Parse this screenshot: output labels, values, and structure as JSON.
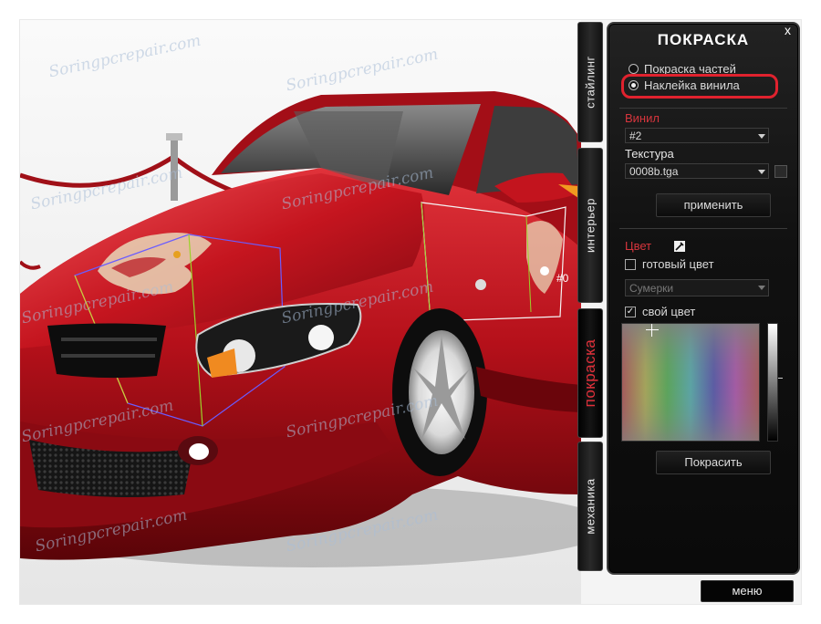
{
  "watermark_text": "Soringpcrepair.com",
  "scene": {
    "gizmo_label": "#0"
  },
  "tabs": [
    {
      "label": "стайлинг"
    },
    {
      "label": "интерьер"
    },
    {
      "label": "покраска",
      "active": true
    },
    {
      "label": "механика"
    }
  ],
  "panel": {
    "title": "ПОКРАСКА",
    "close_label": "x",
    "radio_options": [
      {
        "label": "Покраска частей",
        "selected": false
      },
      {
        "label": "Наклейка винила",
        "selected": true
      }
    ],
    "vinyl_label": "Винил",
    "vinyl_value": "#2",
    "texture_label": "Текстура",
    "texture_value": "0008b.tga",
    "apply_button": "применить",
    "color_label": "Цвет",
    "ready_color_label": "готовый цвет",
    "ready_color_checked": false,
    "preset_value": "Сумерки",
    "own_color_label": "свой цвет",
    "own_color_checked": true,
    "paint_button": "Покрасить"
  },
  "menu_button": "меню",
  "colors": {
    "accent_red": "#e0222e",
    "car_red": "#b8121c",
    "panel_bg": "#111111"
  },
  "icons": [
    "close-icon",
    "eyedropper-icon",
    "dropdown-arrow-icon",
    "more-icon"
  ]
}
